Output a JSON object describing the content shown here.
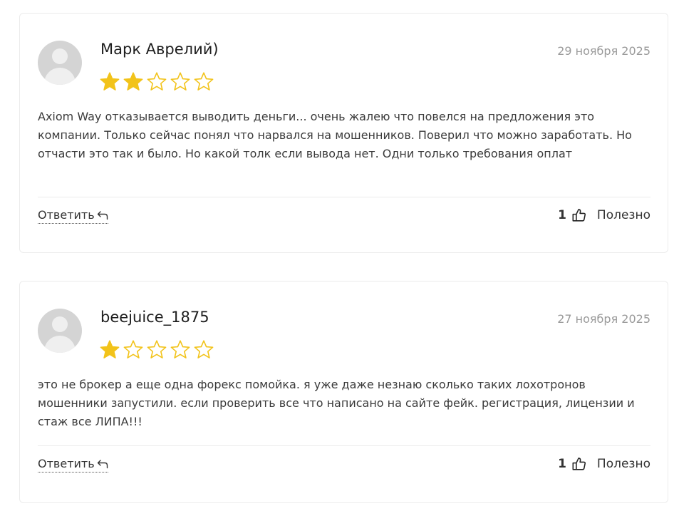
{
  "reviews": [
    {
      "author": "Марк Аврелий)",
      "date": "29 ноября 2025",
      "rating": 2,
      "max_rating": 5,
      "text": "Axiom Way отказывается выводить деньги... очень жалею что повелся на предложения это компании. Только сейчас понял что нарвался на мошенников. Поверил что можно заработать. Но отчасти это так и было. Но какой толк если вывода нет. Одни только требования оплат",
      "reply_label": "Ответить",
      "helpful_count": "1",
      "helpful_label": "Полезно"
    },
    {
      "author": "beejuice_1875",
      "date": "27 ноября 2025",
      "rating": 1,
      "max_rating": 5,
      "text": "это не брокер а еще одна форекс помойка. я уже даже незнаю сколько таких лохотронов мошенники запустили. если проверить все что написано на сайте фейк. регистрация, лицензии и стаж все ЛИПА!!!",
      "reply_label": "Ответить",
      "helpful_count": "1",
      "helpful_label": "Полезно"
    }
  ],
  "colors": {
    "star_filled": "#f2c31a",
    "star_empty_stroke": "#f2c31a",
    "avatar_bg": "#d4d4d4"
  },
  "icons": {
    "reply": "reply-arrow-icon",
    "helpful": "thumbs-up-icon",
    "star": "star-icon",
    "avatar": "default-user-avatar"
  }
}
